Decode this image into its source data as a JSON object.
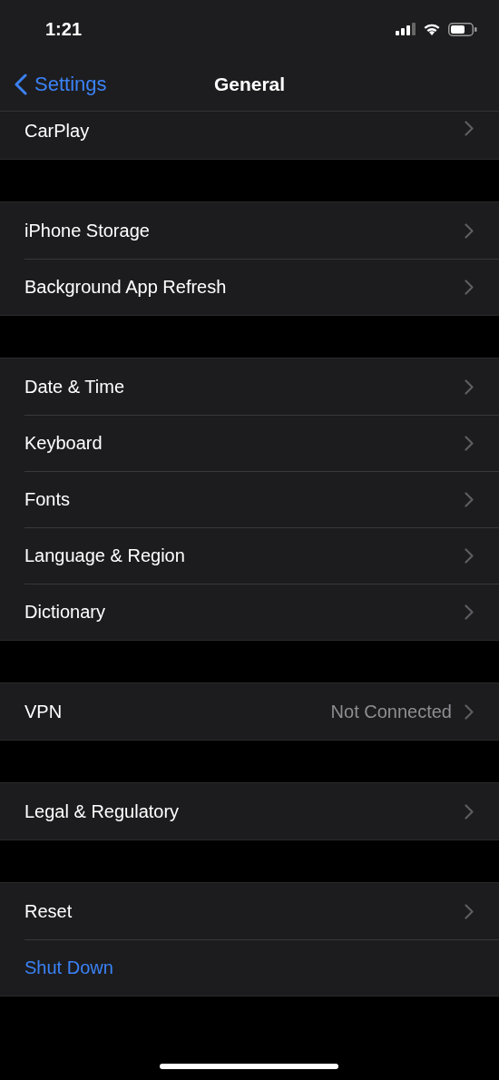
{
  "status_bar": {
    "time": "1:21"
  },
  "nav_bar": {
    "back": "Settings",
    "title": "General"
  },
  "groups": [
    {
      "cut": true,
      "rows": [
        {
          "kind": "link",
          "label": "CarPlay"
        }
      ]
    },
    {
      "rows": [
        {
          "kind": "link",
          "label": "iPhone Storage"
        },
        {
          "kind": "link",
          "label": "Background App Refresh"
        }
      ]
    },
    {
      "rows": [
        {
          "kind": "link",
          "label": "Date & Time"
        },
        {
          "kind": "link",
          "label": "Keyboard"
        },
        {
          "kind": "link",
          "label": "Fonts"
        },
        {
          "kind": "link",
          "label": "Language & Region"
        },
        {
          "kind": "link",
          "label": "Dictionary"
        }
      ]
    },
    {
      "rows": [
        {
          "kind": "link",
          "label": "VPN",
          "value": "Not Connected"
        }
      ]
    },
    {
      "rows": [
        {
          "kind": "link",
          "label": "Legal & Regulatory"
        }
      ]
    },
    {
      "rows": [
        {
          "kind": "link",
          "label": "Reset"
        },
        {
          "kind": "action",
          "label": "Shut Down"
        }
      ]
    }
  ]
}
